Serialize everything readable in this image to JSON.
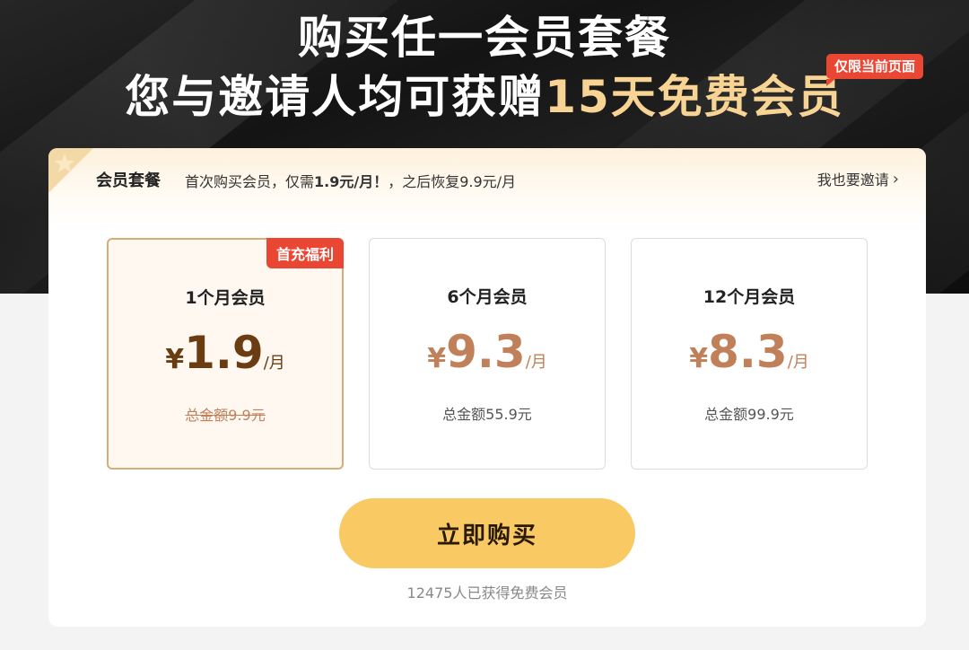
{
  "hero": {
    "line1": "购买任一会员套餐",
    "line2_prefix": "您与邀请人均可获赠",
    "line2_highlight": "15天免费会员",
    "limited_badge": "仅限当前页面"
  },
  "card": {
    "title": "会员套餐",
    "subtitle_prefix": "首次购买会员，仅需",
    "subtitle_bold": "1.9元/月！",
    "subtitle_suffix": "，之后恢复9.9元/月",
    "invite_link": "我也要邀请",
    "options": [
      {
        "name": "1个月会员",
        "currency": "¥",
        "price": "1.9",
        "unit": "/月",
        "total": "总金额9.9元",
        "badge": "首充福利",
        "selected": true
      },
      {
        "name": "6个月会员",
        "currency": "¥",
        "price": "9.3",
        "unit": "/月",
        "total": "总金额55.9元"
      },
      {
        "name": "12个月会员",
        "currency": "¥",
        "price": "8.3",
        "unit": "/月",
        "total": "总金额99.9元"
      }
    ],
    "buy_button": "立即购买",
    "stat": "12475人已获得免费会员"
  },
  "colors": {
    "accent_gold": "#f7d493",
    "button": "#f9c964",
    "badge_red": "#e94634",
    "price_brown": "#c0805a",
    "price_dark": "#6a3c12"
  }
}
